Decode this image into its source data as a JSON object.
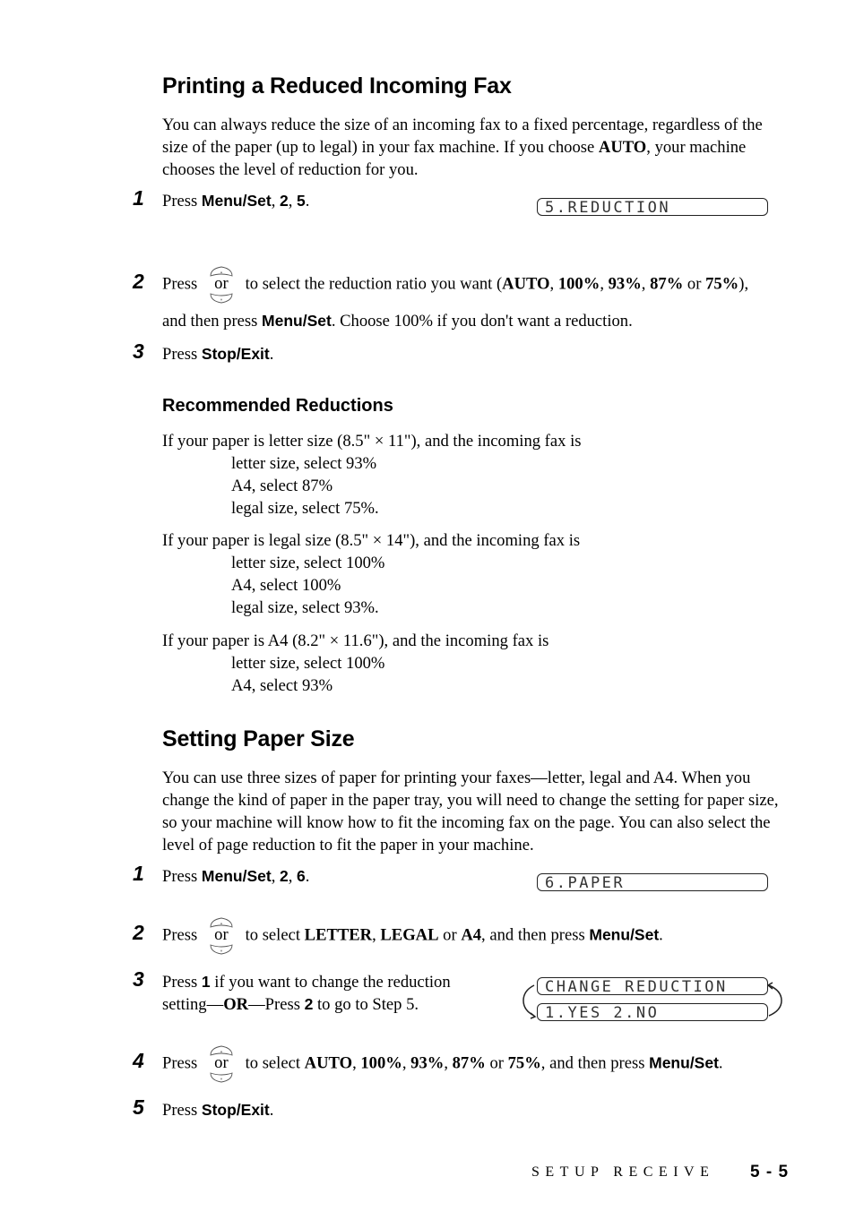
{
  "section1": {
    "title": "Printing a Reduced Incoming Fax",
    "intro": {
      "t1": "You can always reduce the size of an incoming fax to a fixed percentage, regardless of the size of the paper (up to legal) in your fax machine.  If you choose ",
      "b1": "AUTO",
      "t2": ", your machine chooses the level of reduction for you."
    },
    "steps": [
      {
        "number": "1",
        "press": "Press ",
        "key1": "Menu/Set",
        "sep1": ", ",
        "key2": "2",
        "sep2": ", ",
        "key3": "5",
        "end": ".",
        "lcd": "5.REDUCTION"
      },
      {
        "number": "2",
        "press": "Press",
        "or": "or",
        "t1": "to select the reduction ratio you want (",
        "o1": "AUTO",
        "c1": ", ",
        "o2": "100%",
        "c2": ", ",
        "o3": "93%",
        "c3": ", ",
        "o4": "87%",
        "c4": " or ",
        "o5": "75%",
        "t2": "),",
        "line2a": "and then press ",
        "key": "Menu/Set",
        "line2b": ".  Choose 100% if you don't want a reduction."
      },
      {
        "number": "3",
        "press": "Press ",
        "key": "Stop/Exit",
        "end": "."
      }
    ],
    "recommended": {
      "title": "Recommended Reductions",
      "groups": [
        {
          "lead": "If your paper is letter size (8.5\" × 11\"), and the incoming fax is",
          "items": [
            "letter size, select 93%",
            "A4, select 87%",
            "legal size, select 75%."
          ]
        },
        {
          "lead": "If your paper is legal size (8.5\" × 14\"), and the incoming fax is",
          "items": [
            "letter size, select 100%",
            "A4, select 100%",
            "legal size, select 93%."
          ]
        },
        {
          "lead": "If your paper is A4 (8.2\" × 11.6\"), and the incoming fax is",
          "items": [
            "letter size, select 100%",
            "A4, select 93%"
          ]
        }
      ]
    }
  },
  "section2": {
    "title": "Setting Paper Size",
    "intro": "You can use three sizes of paper for printing your faxes—letter, legal and A4.  When you change the kind of paper in the paper tray, you will need to change the setting for paper size, so your machine will know how to fit the incoming fax on the page.  You can also select the level of page reduction to fit the paper in your machine.",
    "steps": [
      {
        "number": "1",
        "press": "Press ",
        "key1": "Menu/Set",
        "sep1": ", ",
        "key2": "2",
        "sep2": ", ",
        "key3": "6",
        "end": ".",
        "lcd": "6.PAPER"
      },
      {
        "number": "2",
        "press": "Press",
        "or": "or",
        "t1": "to select ",
        "o1": "LETTER",
        "c1": ", ",
        "o2": "LEGAL",
        "c2": " or ",
        "o3": "A4",
        "t2": ", and then press ",
        "key": "Menu/Set",
        "end": "."
      },
      {
        "number": "3",
        "press": "Press ",
        "key1": "1",
        "t1": " if you want to change the reduction",
        "t2": "setting—",
        "or_word": "OR",
        "t3": "—Press ",
        "key2": "2",
        "t4": " to go to Step 5.",
        "lcd_line1": "CHANGE REDUCTION",
        "lcd_line2": "1.YES 2.NO"
      },
      {
        "number": "4",
        "press": "Press",
        "or": "or",
        "t1": "to select ",
        "o1": "AUTO",
        "c1": ", ",
        "o2": "100%",
        "c2": ", ",
        "o3": "93%",
        "c3": ", ",
        "o4": "87%",
        "c4": " or ",
        "o5": "75%",
        "t2": ", and then press ",
        "key": "Menu/Set",
        "end": "."
      },
      {
        "number": "5",
        "press": "Press ",
        "key": "Stop/Exit",
        "end": "."
      }
    ]
  },
  "footer": {
    "section": "SETUP RECEIVE",
    "page": "5 - 5"
  },
  "icons": {
    "navigation_keys": "up-down-arrow-keys"
  }
}
